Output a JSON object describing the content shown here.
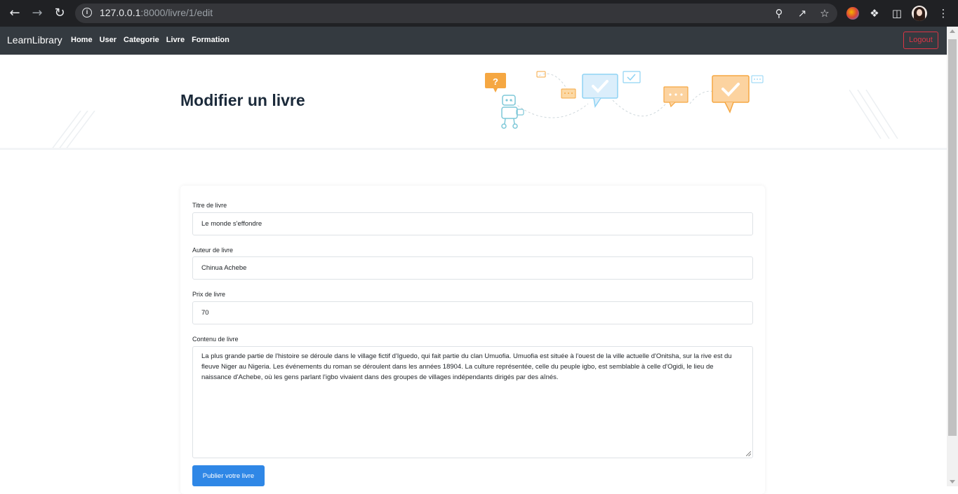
{
  "browser": {
    "url_host": "127.0.0.1",
    "url_rest": ":8000/livre/1/edit"
  },
  "navbar": {
    "brand": "LearnLibrary",
    "links": [
      "Home",
      "User",
      "Categorie",
      "Livre",
      "Formation"
    ],
    "logout_label": "Logout",
    "logout_color": "#dc3545"
  },
  "hero": {
    "title": "Modifier un livre"
  },
  "form": {
    "title_label": "Titre de livre",
    "title_value": "Le monde s'effondre",
    "author_label": "Auteur de livre",
    "author_value": "Chinua Achebe",
    "price_label": "Prix de livre",
    "price_value": "70",
    "content_label": "Contenu de livre",
    "content_value": "La plus grande partie de l'histoire se déroule dans le village fictif d'Iguedo, qui fait partie du clan Umuofia. Umuofia est située à l'ouest de la ville actuelle d'Onitsha, sur la rive est du fleuve Niger au Nigeria. Les événements du roman se déroulent dans les années 18904. La culture représentée, celle du peuple igbo, est semblable à celle d'Ogidi, le lieu de naissance d'Achebe, où les gens parlant l'igbo vivaient dans des groupes de villages indépendants dirigés par des aînés.",
    "submit_label": "Publier votre livre",
    "submit_color": "#2f87e6"
  }
}
